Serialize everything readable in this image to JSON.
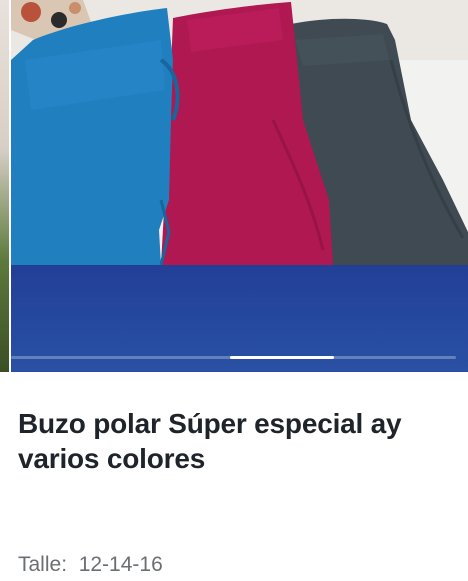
{
  "product": {
    "title": "Buzo polar Súper especial ay varios colores",
    "size_label": "Talle:",
    "size_value": "12-14-16"
  },
  "carousel": {
    "image_alt": "Buzos polar en colores azul, fucsia y gris",
    "current_index": 3,
    "total_slides": 5,
    "colors": {
      "blue": "#1f7fbf",
      "magenta": "#b01852",
      "gray": "#3f4a52",
      "band": "#254a9f"
    }
  }
}
